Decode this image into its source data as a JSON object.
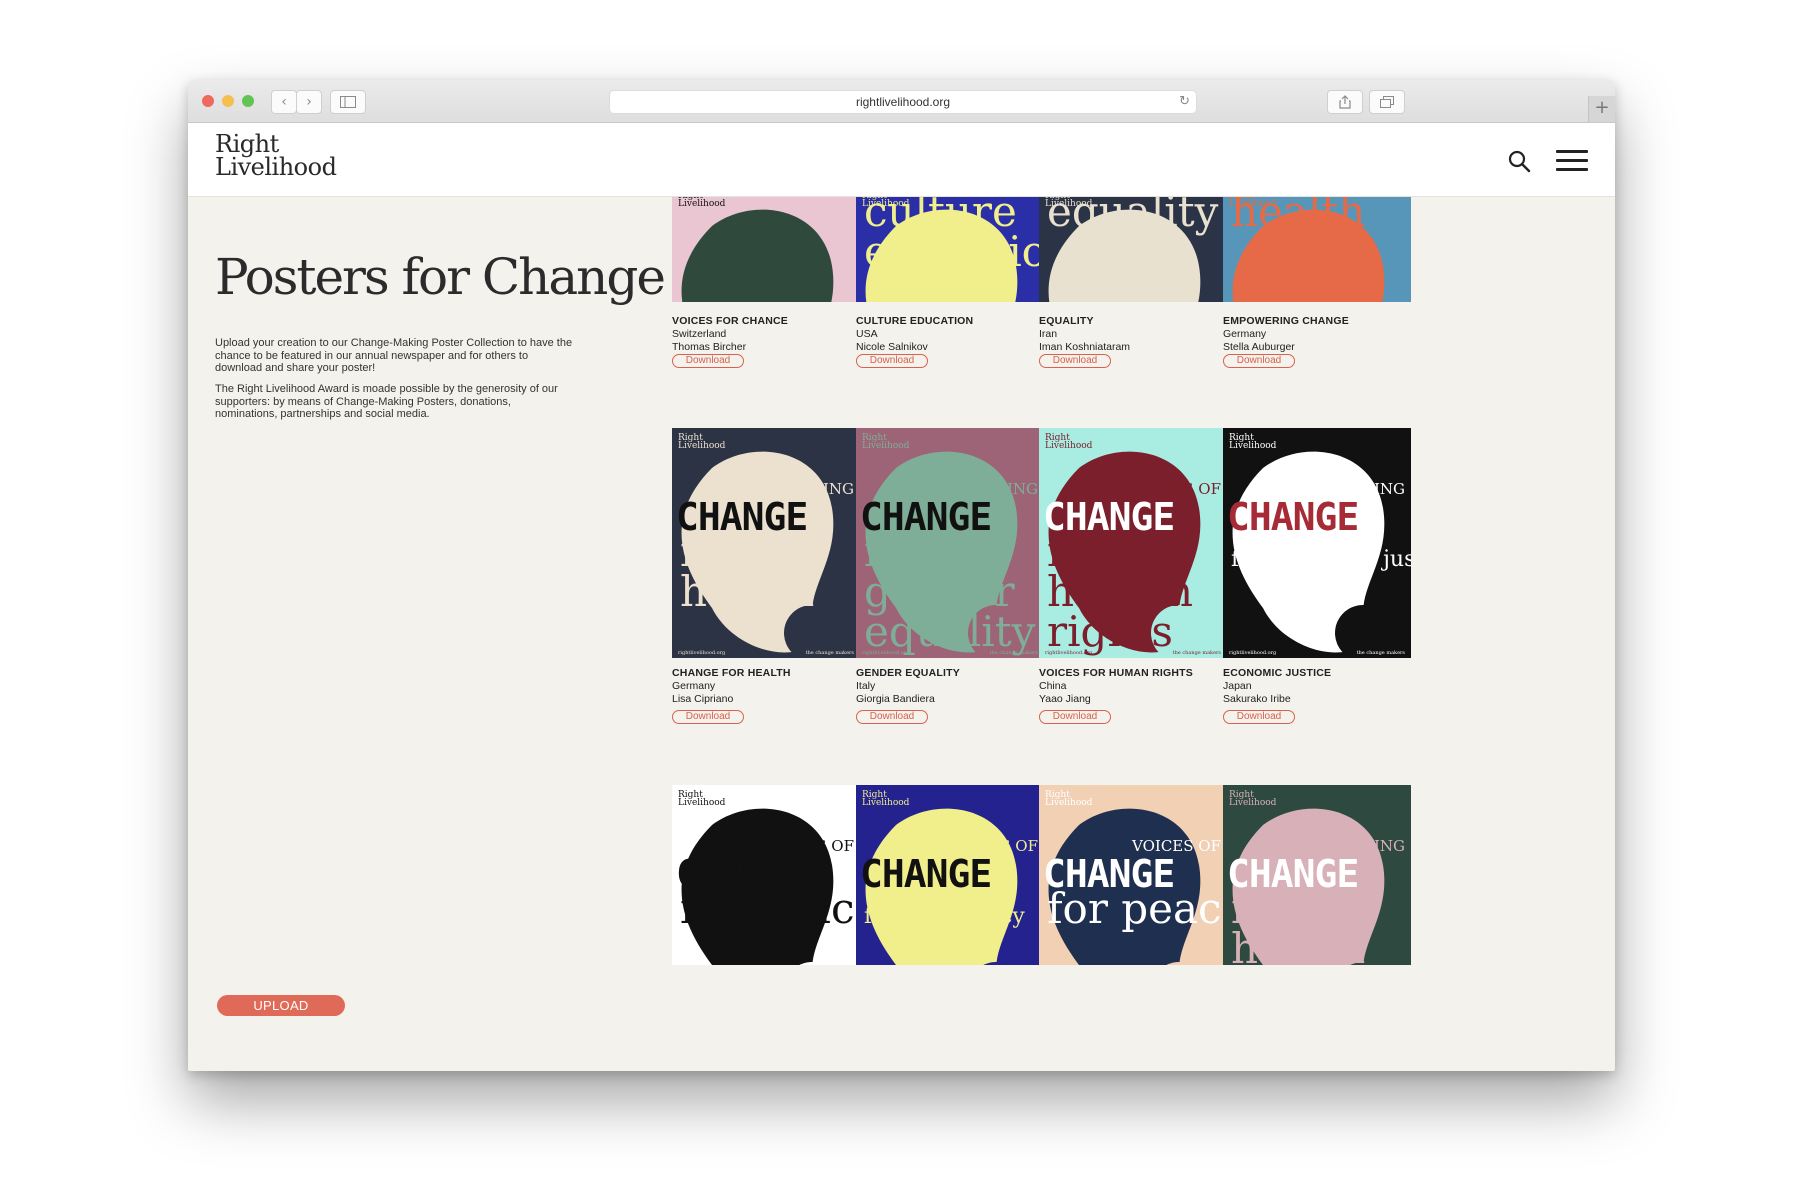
{
  "browser": {
    "url": "rightlivelihood.org",
    "newtab_glyph": "+"
  },
  "site": {
    "logo_line1": "Right",
    "logo_line2": "Livelihood"
  },
  "page": {
    "title": "Posters for Change",
    "intro1": "Upload your creation to our Change-Making Poster Collection to have the chance to be featured in our annual newspaper and for others to download and share your poster!",
    "intro2": "The Right Livelihood Award is moade possible by the generosity of our supporters: by means of Change-Making Posters, donations, nominations, partnerships and social media.",
    "upload_label": "UPLOAD"
  },
  "posters": [
    {
      "title": "VOICES FOR CHANCE",
      "country": "Switzerland",
      "author": "Thomas Bircher",
      "download": "Download",
      "bg": "#e9c6d2",
      "shape": "#2f4a3d",
      "ink": "#111111"
    },
    {
      "title": "CULTURE EDUCATION",
      "country": "USA",
      "author": "Nicole Salnikov",
      "download": "Download",
      "bg": "#2a2fa8",
      "shape": "#f1ee8c",
      "ink": "#f1ee8c",
      "line1": "culture",
      "line2": "education"
    },
    {
      "title": "EQUALITY",
      "country": "Iran",
      "author": "Iman Koshniataram",
      "download": "Download",
      "bg": "#2b3346",
      "shape": "#e9e1cf",
      "ink": "#e9e1cf",
      "line1": "equality"
    },
    {
      "title": "EMPOWERING CHANGE",
      "country": "Germany",
      "author": "Stella Auburger",
      "download": "Download",
      "bg": "#5796b8",
      "shape": "#e66a47",
      "ink": "#e66a47",
      "line1": "health"
    },
    {
      "title": "CHANGE FOR HEALTH",
      "country": "Germany",
      "author": "Lisa Cipriano",
      "download": "Download",
      "bg": "#2c3345",
      "shape": "#ece1cf",
      "ink": "#ece1cf",
      "head": "EMPOWERING",
      "l1": "for",
      "l2": "health"
    },
    {
      "title": "GENDER EQUALITY",
      "country": "Italy",
      "author": "Giorgia Bandiera",
      "download": "Download",
      "bg": "#9d6377",
      "shape": "#7fae98",
      "ink": "#7fae98",
      "head": "ENCOURAGING",
      "l1": "for",
      "l2": "gender",
      "l3": "equality"
    },
    {
      "title": "VOICES FOR HUMAN RIGHTS",
      "country": "China",
      "author": "Yaao Jiang",
      "download": "Download",
      "bg": "#a8ece2",
      "shape": "#7a1f2b",
      "ink": "#7a1f2b",
      "head": "VOICES OF",
      "l1": "for",
      "l2": "human",
      "l3": "rights"
    },
    {
      "title": "ECONOMIC JUSTICE",
      "country": "Japan",
      "author": "Sakurako Iribe",
      "download": "Download",
      "bg": "#111111",
      "shape": "#ffffff",
      "ink": "#ffffff",
      "head": "ENCOURAGING",
      "l1": "for economic justice"
    },
    {
      "bg": "#ffffff",
      "shape": "#111111",
      "ink": "#111111",
      "head": "VOICES OF",
      "l1": "for peace"
    },
    {
      "bg": "#23228f",
      "shape": "#f1ee8c",
      "ink": "#f1ee8c",
      "head": "VOICES OF",
      "l1": "for democracy"
    },
    {
      "bg": "#f2d0b4",
      "shape": "#1f2f4f",
      "ink": "#ffffff",
      "head": "VOICES OF",
      "l1": "for peace"
    },
    {
      "bg": "#2e4a40",
      "shape": "#d7b0b8",
      "ink": "#d7b0b8",
      "head": "ENCOURAGING",
      "l1": "for",
      "l2": "health"
    }
  ],
  "poster_common": {
    "brand1": "Right",
    "brand2": "Livelihood",
    "change": "CHANGE",
    "foot_left": "rightlivelihood.org",
    "foot_right": "the change makers"
  },
  "icons": {
    "back": "chevron-left-icon",
    "forward": "chevron-right-icon",
    "sidebar": "sidebar-icon",
    "share": "share-icon",
    "tabs": "tabs-icon",
    "reload": "reload-icon",
    "search": "search-icon",
    "menu": "hamburger-menu-icon"
  },
  "colors": {
    "accent": "#e06a58",
    "page_bg": "#f4f2ed"
  }
}
